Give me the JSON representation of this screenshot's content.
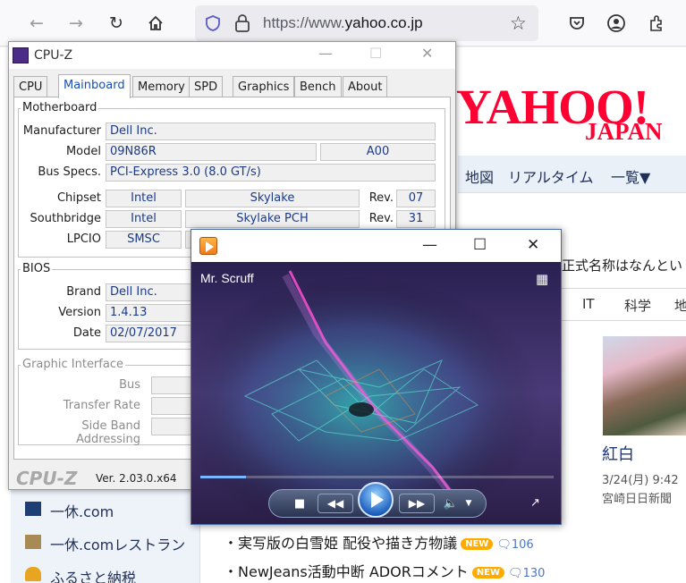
{
  "browser": {
    "url_prefix": "https://www.",
    "url_domain": "yahoo.co.jp",
    "icons": [
      "back-icon",
      "forward-icon",
      "reload-icon",
      "home-icon",
      "shield-icon",
      "lock-icon",
      "star-icon",
      "pocket-icon",
      "account-icon",
      "extensions-icon"
    ]
  },
  "yahoo": {
    "logo_main": "YAHOO!",
    "logo_sub": "JAPAN",
    "nav": [
      "地図",
      "リアルタイム",
      "一覧▼"
    ],
    "topic_text": "正式名称はなんとい",
    "categories": [
      "IT",
      "科学",
      "地"
    ],
    "photo_title": "紅白",
    "photo_date": "3/24(月) 9:42",
    "photo_source": "宮崎日日新聞",
    "services": [
      "一休.com",
      "一休.comレストラン",
      "ふるさと納税"
    ],
    "news": [
      {
        "text": "・実写版の白雪姫 配役や描き方物議",
        "badge": "NEW",
        "comments": "106"
      },
      {
        "text": "・NewJeans活動中断 ADORコメント",
        "badge": "NEW",
        "comments": "130"
      }
    ]
  },
  "cpuz": {
    "title": "CPU-Z",
    "tabs": [
      "CPU",
      "Mainboard",
      "Memory",
      "SPD",
      "Graphics",
      "Bench",
      "About"
    ],
    "active_tab": "Mainboard",
    "motherboard": {
      "label": "Motherboard",
      "manufacturer_label": "Manufacturer",
      "manufacturer": "Dell Inc.",
      "model_label": "Model",
      "model": "09N86R",
      "model_rev": "A00",
      "bus_label": "Bus Specs.",
      "bus": "PCI-Express 3.0 (8.0 GT/s)",
      "chipset_label": "Chipset",
      "chipset_vendor": "Intel",
      "chipset_name": "Skylake",
      "chipset_rev": "07",
      "southbridge_label": "Southbridge",
      "southbridge_vendor": "Intel",
      "southbridge_name": "Skylake PCH",
      "southbridge_rev": "31",
      "lpcio_label": "LPCIO",
      "lpcio_vendor": "SMSC",
      "rev_label": "Rev."
    },
    "bios": {
      "label": "BIOS",
      "brand_label": "Brand",
      "brand": "Dell Inc.",
      "version_label": "Version",
      "version": "1.4.13",
      "date_label": "Date",
      "date": "02/07/2017"
    },
    "graphic_interface": {
      "label": "Graphic Interface",
      "bus_label": "Bus",
      "transfer_label": "Transfer Rate",
      "sideband_label": "Side Band Addressing"
    },
    "footer_logo": "CPU-Z",
    "version": "Ver. 2.03.0.x64"
  },
  "player": {
    "artist": "Mr. Scruff",
    "progress": 0.13,
    "accent": "#7ab6ff"
  }
}
